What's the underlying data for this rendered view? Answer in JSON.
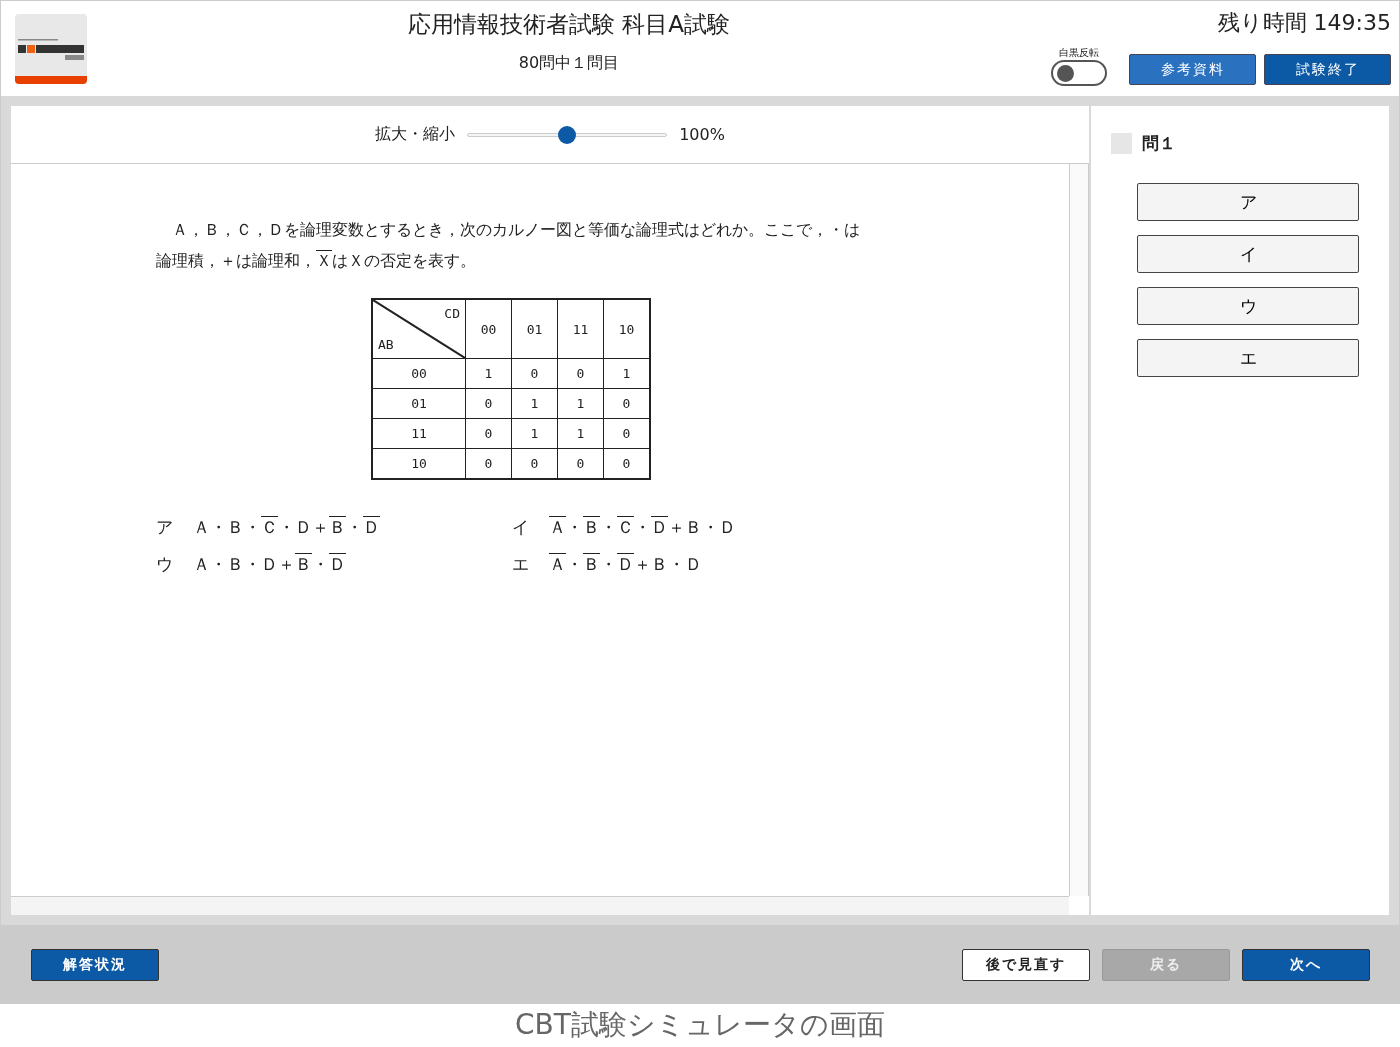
{
  "header": {
    "title": "応用情報技術者試験 科目A試験",
    "progress": "80問中１問目",
    "timer_label": "残り時間",
    "timer": "149:35",
    "invert_toggle": {
      "label": "白黒反転",
      "on": false
    },
    "buttons": [
      {
        "label": "参考資料",
        "kind": "secondary"
      },
      {
        "label": "試験終了",
        "kind": "primary"
      }
    ]
  },
  "zoom": {
    "label": "拡大・縮小",
    "level": 0.5,
    "reading": "100%"
  },
  "question": {
    "text": [
      {
        "text": "Ａ，Ｂ，Ｃ，Ｄを論理変数とするとき，次のカルノー図と等価な論理式はどれか。ここで，・は論理積，＋は論理和，",
        "bar": false
      },
      {
        "text": "Ｘ",
        "bar": true
      },
      {
        "text": "はＸの否定を表す。",
        "bar": false
      }
    ],
    "kmap": {
      "col_var": "CD",
      "row_var": "AB",
      "columns": [
        "00",
        "01",
        "11",
        "10"
      ],
      "rows": [
        {
          "label": "00",
          "cells": [
            "1",
            "0",
            "0",
            "1"
          ]
        },
        {
          "label": "01",
          "cells": [
            "0",
            "1",
            "1",
            "0"
          ]
        },
        {
          "label": "11",
          "cells": [
            "0",
            "1",
            "1",
            "0"
          ]
        },
        {
          "label": "10",
          "cells": [
            "0",
            "0",
            "0",
            "0"
          ]
        }
      ]
    },
    "choices": [
      {
        "mark": "ア",
        "formula": [
          {
            "text": "Ａ・Ｂ・",
            "bar": false
          },
          {
            "text": "Ｃ",
            "bar": true
          },
          {
            "text": "・Ｄ＋",
            "bar": false
          },
          {
            "text": "Ｂ",
            "bar": true
          },
          {
            "text": "・",
            "bar": false
          },
          {
            "text": "Ｄ",
            "bar": true
          }
        ]
      },
      {
        "mark": "イ",
        "formula": [
          {
            "text": "Ａ",
            "bar": true
          },
          {
            "text": "・",
            "bar": false
          },
          {
            "text": "Ｂ",
            "bar": true
          },
          {
            "text": "・",
            "bar": false
          },
          {
            "text": "Ｃ",
            "bar": true
          },
          {
            "text": "・",
            "bar": false
          },
          {
            "text": "Ｄ",
            "bar": true
          },
          {
            "text": "＋Ｂ・Ｄ",
            "bar": false
          }
        ]
      },
      {
        "mark": "ウ",
        "formula": [
          {
            "text": "Ａ・Ｂ・Ｄ＋",
            "bar": false
          },
          {
            "text": "Ｂ",
            "bar": true
          },
          {
            "text": "・",
            "bar": false
          },
          {
            "text": "Ｄ",
            "bar": true
          }
        ]
      },
      {
        "mark": "エ",
        "formula": [
          {
            "text": "Ａ",
            "bar": true
          },
          {
            "text": "・",
            "bar": false
          },
          {
            "text": "Ｂ",
            "bar": true
          },
          {
            "text": "・",
            "bar": false
          },
          {
            "text": "Ｄ",
            "bar": true
          },
          {
            "text": "＋Ｂ・Ｄ",
            "bar": false
          }
        ]
      }
    ]
  },
  "answer_panel": {
    "question_label": "問１",
    "flagged": false,
    "options": [
      {
        "label": "ア",
        "selected": false
      },
      {
        "label": "イ",
        "selected": false
      },
      {
        "label": "ウ",
        "selected": false
      },
      {
        "label": "エ",
        "selected": false
      }
    ]
  },
  "footer": {
    "status_button": "解答状況",
    "buttons": [
      {
        "label": "後で見直す",
        "kind": "outline",
        "disabled": false
      },
      {
        "label": "戻る",
        "kind": "primary",
        "disabled": true
      },
      {
        "label": "次へ",
        "kind": "primary",
        "disabled": false
      }
    ]
  },
  "caption": "CBT試験シミュレータの画面"
}
